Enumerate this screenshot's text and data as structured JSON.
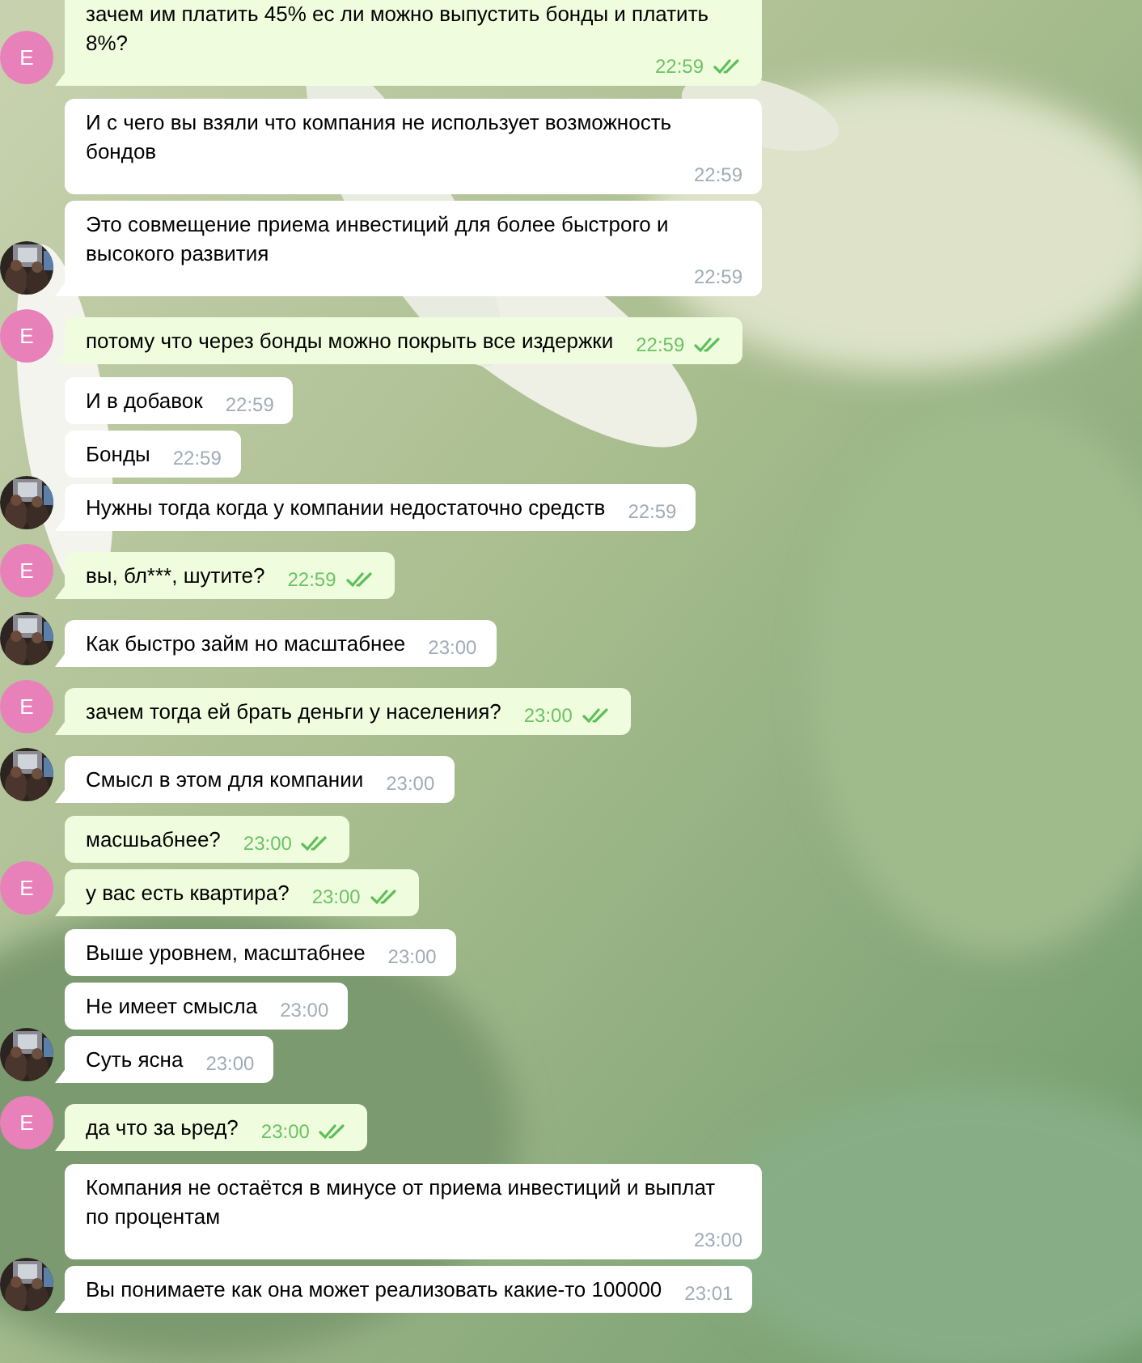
{
  "groups": [
    {
      "kind": "outgoing",
      "avatar": {
        "kind": "letter",
        "letter": "E"
      },
      "messages": [
        {
          "text": "зачем им платить 45% ес ли можно выпустить бонды и платить 8%?",
          "time": "22:59",
          "read": true
        }
      ]
    },
    {
      "kind": "incoming",
      "avatar": {
        "kind": "picture"
      },
      "messages": [
        {
          "text": "И с чего вы взяли что компания не использует возможность бондов",
          "time": "22:59"
        },
        {
          "text": "Это совмещение приема инвестиций для более быстрого и высокого развития",
          "time": "22:59"
        }
      ]
    },
    {
      "kind": "outgoing",
      "avatar": {
        "kind": "letter",
        "letter": "E"
      },
      "messages": [
        {
          "text": "потому что через бонды можно покрыть все издержки",
          "time": "22:59",
          "read": true
        }
      ]
    },
    {
      "kind": "incoming",
      "avatar": {
        "kind": "picture"
      },
      "messages": [
        {
          "text": "И в добавок",
          "time": "22:59"
        },
        {
          "text": "Бонды",
          "time": "22:59"
        },
        {
          "text": "Нужны тогда когда у компании недостаточно средств",
          "time": "22:59"
        }
      ]
    },
    {
      "kind": "outgoing",
      "avatar": {
        "kind": "letter",
        "letter": "E"
      },
      "messages": [
        {
          "text": "вы, бл***, шутите?",
          "time": "22:59",
          "read": true
        }
      ]
    },
    {
      "kind": "incoming",
      "avatar": {
        "kind": "picture"
      },
      "messages": [
        {
          "text": "Как быстро займ но масштабнее",
          "time": "23:00"
        }
      ]
    },
    {
      "kind": "outgoing",
      "avatar": {
        "kind": "letter",
        "letter": "E"
      },
      "messages": [
        {
          "text": "зачем тогда ей брать деньги у населения?",
          "time": "23:00",
          "read": true
        }
      ]
    },
    {
      "kind": "incoming",
      "avatar": {
        "kind": "picture"
      },
      "messages": [
        {
          "text": "Смысл в этом для компании",
          "time": "23:00"
        }
      ]
    },
    {
      "kind": "outgoing",
      "avatar": {
        "kind": "letter",
        "letter": "E"
      },
      "messages": [
        {
          "text": "масшьабнее?",
          "time": "23:00",
          "read": true
        },
        {
          "text": "у вас есть квартира?",
          "time": "23:00",
          "read": true
        }
      ]
    },
    {
      "kind": "incoming",
      "avatar": {
        "kind": "picture"
      },
      "messages": [
        {
          "text": "Выше уровнем, масштабнее",
          "time": "23:00"
        },
        {
          "text": "Не имеет смысла",
          "time": "23:00"
        },
        {
          "text": "Суть ясна",
          "time": "23:00"
        }
      ]
    },
    {
      "kind": "outgoing",
      "avatar": {
        "kind": "letter",
        "letter": "E"
      },
      "messages": [
        {
          "text": "да что за ьред?",
          "time": "23:00",
          "read": true
        }
      ]
    },
    {
      "kind": "incoming",
      "avatar": {
        "kind": "picture"
      },
      "messages": [
        {
          "text": "Компания не остаётся в минусе от приема инвестиций и выплат по процентам",
          "time": "23:00"
        },
        {
          "text": "Вы понимаете как она может реализовать какие-то 100000",
          "time": "23:01"
        }
      ]
    }
  ]
}
